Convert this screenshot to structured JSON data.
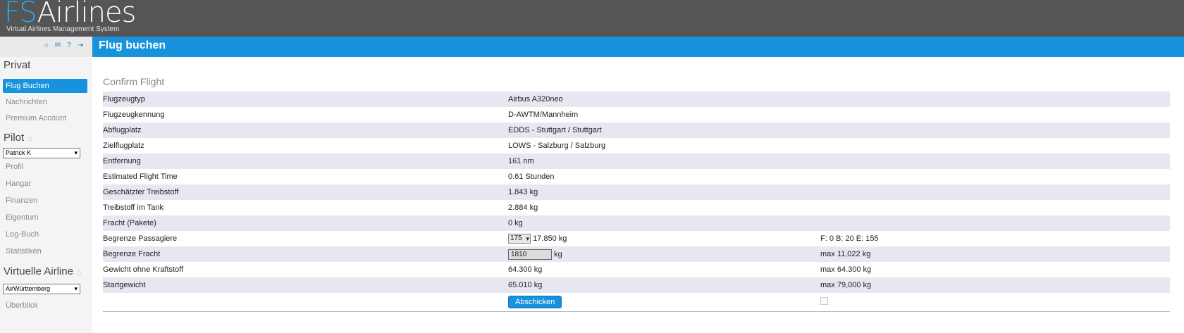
{
  "header": {
    "logo_fs": "FS",
    "logo_airlines": "Airlines",
    "tagline": "Virtual Airlines Management System"
  },
  "page_title": "Flug buchen",
  "sidebar": {
    "private_title": "Privat",
    "private_items": [
      {
        "label": "Flug Buchen",
        "active": true
      },
      {
        "label": "Nachrichten"
      },
      {
        "label": "Premium Account"
      }
    ],
    "pilot_title": "Pilot",
    "pilot_select": "Patrick K",
    "pilot_items": [
      {
        "label": "Profil"
      },
      {
        "label": "Hangar"
      },
      {
        "label": "Finanzen"
      },
      {
        "label": "Eigentum"
      },
      {
        "label": "Log-Buch"
      },
      {
        "label": "Statistiken"
      }
    ],
    "va_title": "Virtuelle Airline",
    "va_select": "AirWürttemberg",
    "va_items": [
      {
        "label": "Überblick"
      }
    ]
  },
  "main": {
    "heading": "Confirm Flight",
    "rows": [
      {
        "label": "Flugzeugtyp",
        "value": "Airbus A320neo"
      },
      {
        "label": "Flugzeugkennung",
        "value": "D-AWTM/Mannheim"
      },
      {
        "label": "Abflugplatz",
        "value": "EDDS - Stuttgart / Stuttgart"
      },
      {
        "label": "Zielflugplatz",
        "value": "LOWS - Salzburg / Salzburg"
      },
      {
        "label": "Entfernung",
        "value": "161 nm"
      },
      {
        "label": "Estimated Flight Time",
        "value": "0.61 Stunden"
      },
      {
        "label": "Geschätzter Treibstoff",
        "value": "1.843 kg"
      },
      {
        "label": "Treibstoff im Tank",
        "value": "2.884 kg"
      },
      {
        "label": "Fracht (Pakete)",
        "value": "0 kg"
      }
    ],
    "passengers": {
      "label": "Begrenze Passagiere",
      "select_value": "175",
      "weight": "17.850 kg",
      "extra": "F: 0 B: 20 E: 155"
    },
    "cargo": {
      "label": "Begrenze Fracht",
      "input_value": "1810",
      "unit": "kg",
      "extra": "max 11,022 kg"
    },
    "zfw": {
      "label": "Gewicht ohne Kraftstoff",
      "value": "64.300 kg",
      "extra": "max 64.300 kg"
    },
    "tow": {
      "label": "Startgewicht",
      "value": "65.010 kg",
      "extra": "max 79,000 kg"
    },
    "submit_label": "Abschicken"
  }
}
